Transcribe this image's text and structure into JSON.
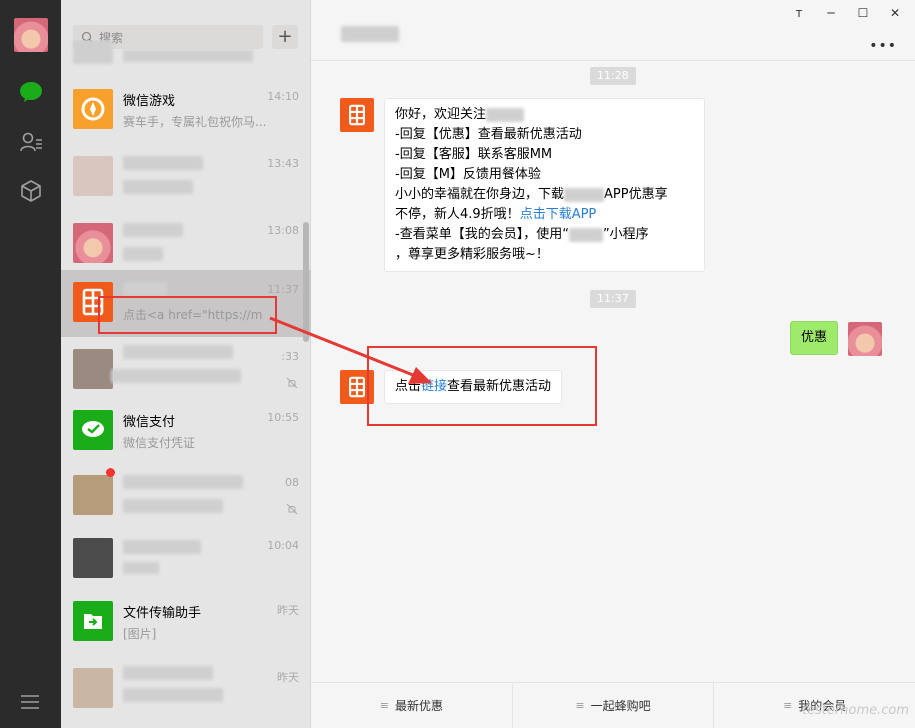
{
  "search": {
    "placeholder": "搜索",
    "add_glyph": "+"
  },
  "window": {
    "min": "─",
    "pin": "ᴛ",
    "max": "☐",
    "close": "✕",
    "more": "•••"
  },
  "list": [
    {
      "title": "",
      "sub": "",
      "time": "",
      "icon": "group-avatar-icon"
    },
    {
      "title": "微信游戏",
      "sub": "赛车手，专属礼包祝你马...",
      "time": "14:10",
      "icon": "game-icon"
    },
    {
      "title": "",
      "sub": "",
      "time": "13:43",
      "icon": "group-avatar-icon"
    },
    {
      "title": "",
      "sub": "",
      "time": "13:08",
      "icon": "baby-avatar-icon"
    },
    {
      "title": "",
      "sub": "点击<a href=\"https://m",
      "time": "11:37",
      "icon": "brand-logo-icon"
    },
    {
      "title": "",
      "sub": "",
      "time": ":33",
      "icon": "group-avatar-icon"
    },
    {
      "title": "微信支付",
      "sub": "微信支付凭证",
      "time": "10:55",
      "icon": "wechat-pay-icon"
    },
    {
      "title": "",
      "sub": "",
      "time": "08",
      "icon": "group-avatar-icon"
    },
    {
      "title": "",
      "sub": "",
      "time": "10:04",
      "icon": "person-avatar-icon"
    },
    {
      "title": "文件传输助手",
      "sub": "[图片]",
      "time": "昨天",
      "icon": "file-transfer-icon"
    },
    {
      "title": "",
      "sub": "",
      "time": "昨天",
      "icon": "group-avatar-icon"
    }
  ],
  "chat": {
    "time_1": "11:28",
    "welcome": {
      "line1": "你好，欢迎关注",
      "line2": "-回复【优惠】查看最新优惠活动",
      "line3": "-回复【客服】联系客服MM",
      "line4": "-回复【M】反馈用餐体验",
      "line5a": "小小的幸福就在你身边，下载",
      "line5b": "APP优惠享",
      "line6a": "不停，新人4.9折哦！",
      "line6_link": "点击下载APP",
      "line7a": "-查看菜单【我的会员】，使用“",
      "line7b": "”小程序",
      "line8": "，尊享更多精彩服务哦~！"
    },
    "time_2": "11:37",
    "my_message": "优惠",
    "reply": {
      "before": "点击",
      "link": "链接",
      "after": "查看最新优惠活动"
    }
  },
  "menu": [
    {
      "label": "最新优惠",
      "glyph": "≡"
    },
    {
      "label": "一起蜂购吧",
      "glyph": "≡"
    },
    {
      "label": "我的会员",
      "glyph": "≡"
    }
  ],
  "watermark": "testerhome.com",
  "colors": {
    "accent": "#f05a1a",
    "link": "#2a7ed2",
    "annotation": "#e53935",
    "wechat_green": "#1aad19"
  }
}
